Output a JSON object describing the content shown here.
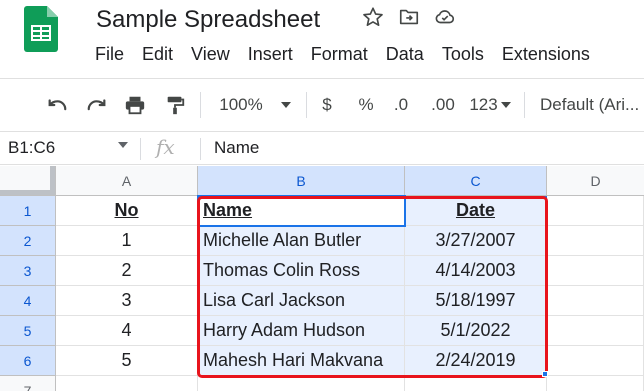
{
  "app": {
    "title": "Sample Spreadsheet",
    "brand_color": "#0f9d58"
  },
  "menu": [
    "File",
    "Edit",
    "View",
    "Insert",
    "Format",
    "Data",
    "Tools",
    "Extensions"
  ],
  "toolbar": {
    "zoom": "100%",
    "currency": "$",
    "percent": "%",
    "decrease_decimal": ".0",
    "increase_decimal": ".00",
    "more_formats": "123",
    "font": "Default (Ari..."
  },
  "formula_bar": {
    "name_box": "B1:C6",
    "fx": "fx",
    "content": "Name"
  },
  "grid": {
    "columns": [
      "A",
      "B",
      "C",
      "D"
    ],
    "rows": [
      "1",
      "2",
      "3",
      "4",
      "5",
      "6",
      "7"
    ],
    "data": [
      [
        "No",
        "Name",
        "Date"
      ],
      [
        "1",
        "Michelle Alan Butler",
        "3/27/2007"
      ],
      [
        "2",
        "Thomas Colin Ross",
        "4/14/2003"
      ],
      [
        "3",
        "Lisa Carl Jackson",
        "5/18/1997"
      ],
      [
        "4",
        "Harry Adam Hudson",
        "5/1/2022"
      ],
      [
        "5",
        "Mahesh Hari Makvana",
        "2/24/2019"
      ]
    ],
    "selection_color": "#1a73e8",
    "highlight_color": "#e8141c"
  }
}
